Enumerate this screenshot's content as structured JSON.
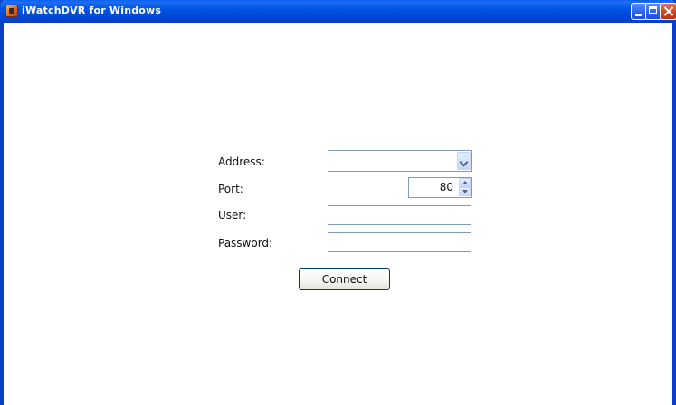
{
  "window": {
    "title": "iWatchDVR for Windows",
    "app_icon": "app-icon",
    "controls": {
      "minimize_icon": "minimize-icon",
      "maximize_icon": "maximize-icon",
      "close_icon": "close-icon"
    },
    "colors": {
      "titlebar": "#0054e3",
      "close_button": "#d24a24",
      "background": "#ffffff"
    }
  },
  "login_form": {
    "address": {
      "label": "Address:",
      "value": "",
      "dropdown_icon": "chevron-down-icon"
    },
    "port": {
      "label": "Port:",
      "value": "80",
      "up_icon": "arrow-up-icon",
      "down_icon": "arrow-down-icon"
    },
    "user": {
      "label": "User:",
      "value": ""
    },
    "password": {
      "label": "Password:",
      "value": ""
    },
    "connect_label": "Connect"
  }
}
